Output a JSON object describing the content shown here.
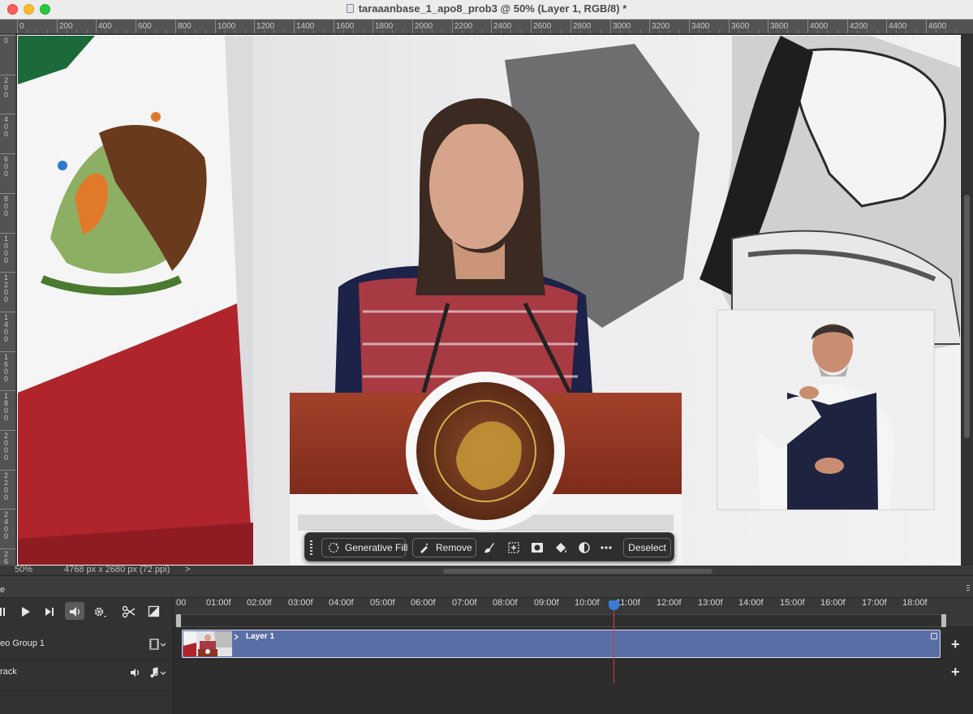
{
  "window": {
    "title": "taraaanbase_1_apo8_prob3 @ 50% (Layer 1, RGB/8) *"
  },
  "ruler": {
    "h_labels": [
      "0",
      "200",
      "400",
      "600",
      "800",
      "1000",
      "1200",
      "1400",
      "1600",
      "1800",
      "2000",
      "2200",
      "2400",
      "2600",
      "2800",
      "3000",
      "3200",
      "3400",
      "3600",
      "3800",
      "4000",
      "4200",
      "4400",
      "4600"
    ],
    "v_labels": [
      "0",
      "200",
      "400",
      "600",
      "800",
      "1000",
      "1200",
      "1400",
      "1600",
      "1800",
      "2000",
      "2200",
      "2400",
      "26"
    ]
  },
  "status": {
    "zoom": "50%",
    "dimensions": "4768 px x 2680 px (72 ppi)",
    "more": ">"
  },
  "taskbar": {
    "generative_fill": "Generative Fill",
    "remove": "Remove",
    "deselect": "Deselect"
  },
  "timeline": {
    "panel_tab": "e",
    "time_labels": [
      "00",
      "01:00f",
      "02:00f",
      "03:00f",
      "04:00f",
      "05:00f",
      "06:00f",
      "07:00f",
      "08:00f",
      "09:00f",
      "10:00f",
      "11:00f",
      "12:00f",
      "13:00f",
      "14:00f",
      "15:00f",
      "16:00f",
      "17:00f",
      "18:00f"
    ],
    "tracks": [
      {
        "name": "eo Group 1",
        "clip_label": "Layer 1"
      },
      {
        "name": "rack"
      }
    ],
    "playhead": "10:18f"
  },
  "colors": {
    "clip": "#5a6ea6",
    "playhead": "#e03a3a",
    "panel_bg": "#323232"
  }
}
